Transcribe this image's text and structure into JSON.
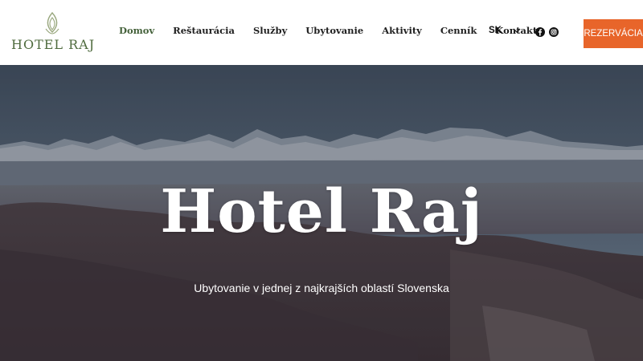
{
  "brand": {
    "name": "HOTEL RAJ",
    "logo_icon": "lotus-leaf-icon",
    "color": "#4f6b3e"
  },
  "nav": {
    "items": [
      {
        "label": "Domov",
        "active": true
      },
      {
        "label": "Reštaurácia",
        "active": false
      },
      {
        "label": "Služby",
        "active": false
      },
      {
        "label": "Ubytovanie",
        "active": false
      },
      {
        "label": "Aktivity",
        "active": false
      },
      {
        "label": "Cenník",
        "active": false
      },
      {
        "label": "Kontakt",
        "active": false
      }
    ],
    "active_color": "#44613a"
  },
  "language": {
    "selected": "SK",
    "icon": "chevron-down-icon"
  },
  "social": [
    {
      "icon": "facebook-icon"
    },
    {
      "icon": "instagram-icon"
    }
  ],
  "cta": {
    "label": "REZERVÁCIA",
    "color": "#e8652a"
  },
  "hero": {
    "title": "Hotel Raj",
    "subtitle": "Ubytovanie v jednej z najkrajších oblastí Slovenska"
  }
}
